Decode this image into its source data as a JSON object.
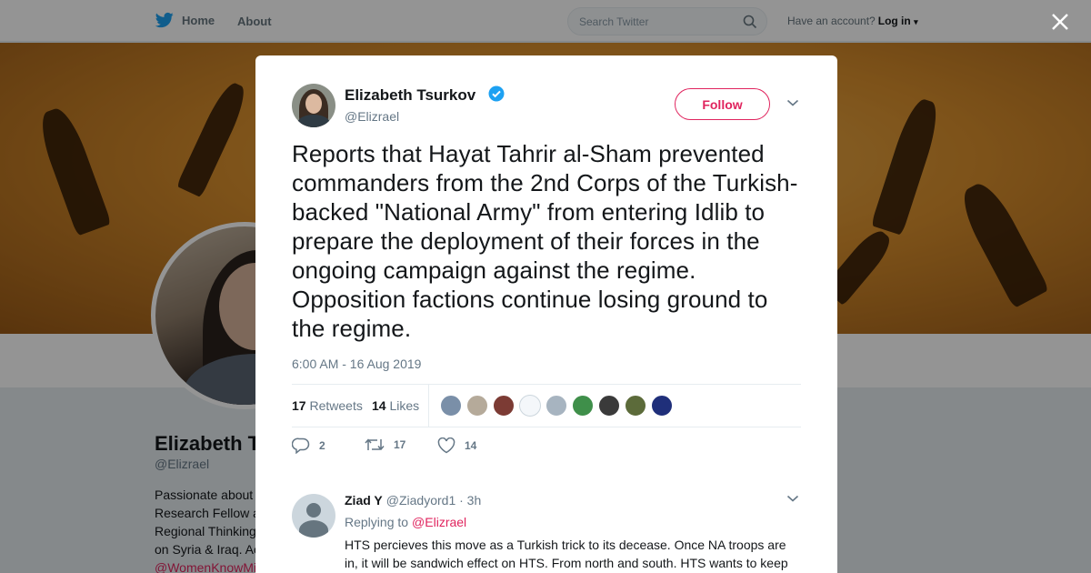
{
  "nav": {
    "home": "Home",
    "about": "About",
    "search_placeholder": "Search Twitter",
    "account_prompt": "Have an account?",
    "login": "Log in"
  },
  "profile": {
    "name": "Elizabeth Tsurkov",
    "handle": "@Elizrael",
    "bio_lines": [
      "Passionate about",
      "Research Fellow a",
      "Regional Thinking",
      "on Syria & Iraq. Ac"
    ],
    "bio_link": "@WomenKnowMi"
  },
  "tweet": {
    "author_name": "Elizabeth Tsurkov",
    "author_handle": "@Elizrael",
    "follow_label": "Follow",
    "text": "Reports that Hayat Tahrir al-Sham prevented commanders from the 2nd Corps of the Turkish-backed \"National Army\" from entering Idlib to prepare the deployment of their forces in the ongoing campaign against the regime. Opposition factions continue losing ground to the regime.",
    "timestamp": "6:00 AM - 16 Aug 2019",
    "retweets_count": "17",
    "retweets_label": "Retweets",
    "likes_count": "14",
    "likes_label": "Likes",
    "replies_count": "2",
    "rt_action_count": "17",
    "like_action_count": "14"
  },
  "likers": [
    {
      "color": "#7a8fa8"
    },
    {
      "color": "#b5aa9a"
    },
    {
      "color": "#7c3b34"
    },
    {
      "color": "#f4f7fa"
    },
    {
      "color": "#a7b4c0"
    },
    {
      "color": "#3f8f4a"
    },
    {
      "color": "#3a3a3a"
    },
    {
      "color": "#5c6b3a"
    },
    {
      "color": "#1f2f7a"
    }
  ],
  "reply": {
    "name": "Ziad Y",
    "handle": "@Ziadyord1",
    "time": "· 3h",
    "replying_to_label": "Replying to",
    "replying_to": "@Elizrael",
    "text": "HTS percieves this move as a Turkish trick to its decease. Once NA troops are in, it will be sandwich effect on HTS. From north and south. HTS wants to keep"
  },
  "colors": {
    "accent": "#e0245e",
    "twitter_blue": "#1da1f2",
    "verified": "#1da1f2"
  }
}
